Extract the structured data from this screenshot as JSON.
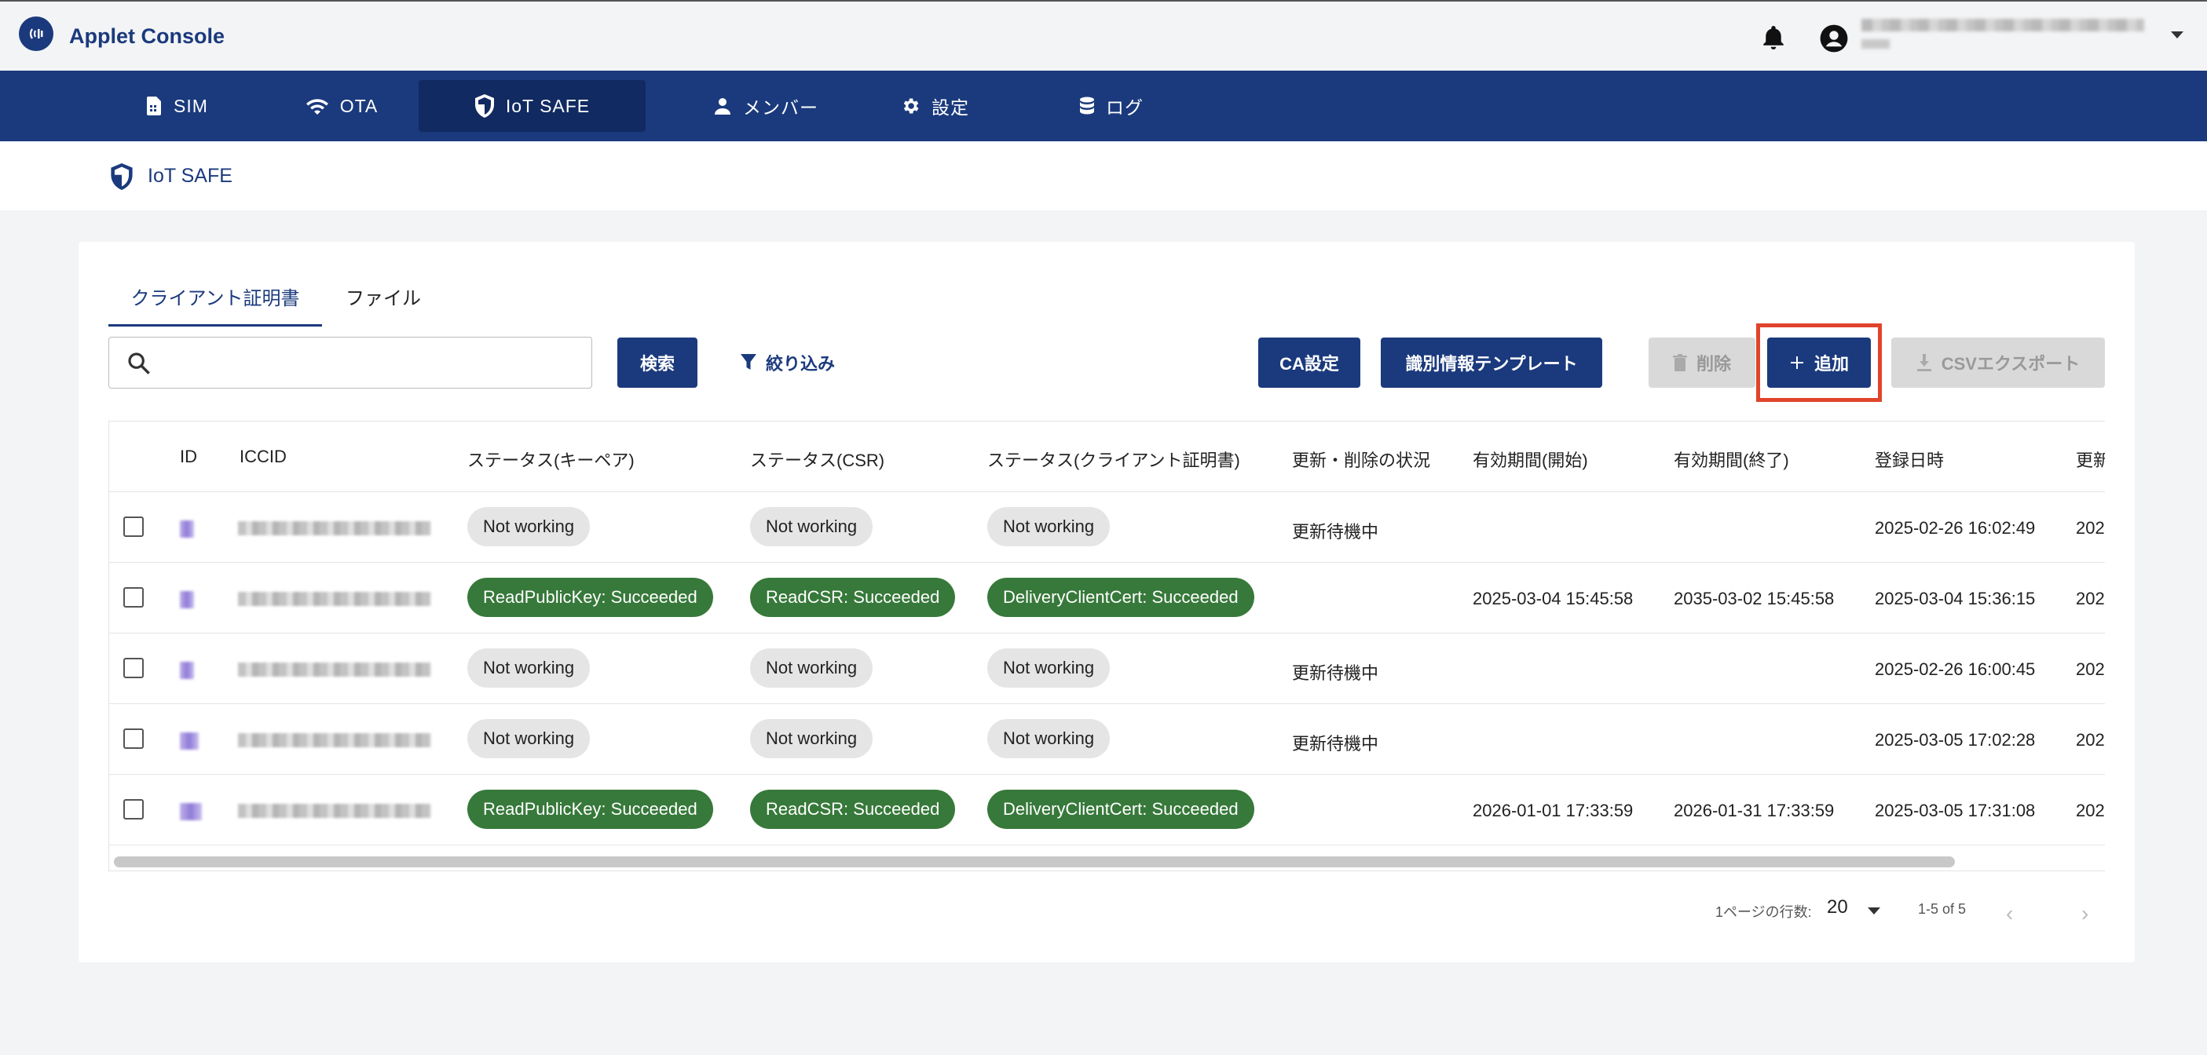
{
  "app": {
    "title": "Applet Console"
  },
  "nav": [
    {
      "label": "SIM",
      "icon": "sim-card-icon"
    },
    {
      "label": "OTA",
      "icon": "wifi-icon"
    },
    {
      "label": "IoT SAFE",
      "icon": "shield-icon"
    },
    {
      "label": "メンバー",
      "icon": "person-icon"
    },
    {
      "label": "設定",
      "icon": "gear-icon"
    },
    {
      "label": "ログ",
      "icon": "database-icon"
    }
  ],
  "page": {
    "title": "IoT SAFE"
  },
  "tabs": [
    {
      "label": "クライアント証明書",
      "active": true
    },
    {
      "label": "ファイル",
      "active": false
    }
  ],
  "search": {
    "value": "",
    "placeholder": ""
  },
  "buttons": {
    "search": "検索",
    "filter": "絞り込み",
    "ca_settings": "CA設定",
    "id_template": "識別情報テンプレート",
    "delete": "削除",
    "add": "追加",
    "csv_export": "CSVエクスポート"
  },
  "table": {
    "columns": [
      "ID",
      "ICCID",
      "ステータス(キーペア)",
      "ステータス(CSR)",
      "ステータス(クライアント証明書)",
      "更新・削除の状況",
      "有効期間(開始)",
      "有効期間(終了)",
      "登録日時",
      "更新"
    ],
    "rows": [
      {
        "keypair": "Not working",
        "csr": "Not working",
        "cert": "Not working",
        "update": "更新待機中",
        "start": "",
        "end": "",
        "registered": "2025-02-26 16:02:49",
        "updated": "202"
      },
      {
        "keypair": "ReadPublicKey: Succeeded",
        "csr": "ReadCSR: Succeeded",
        "cert": "DeliveryClientCert: Succeeded",
        "update": "",
        "start": "2025-03-04 15:45:58",
        "end": "2035-03-02 15:45:58",
        "registered": "2025-03-04 15:36:15",
        "updated": "202"
      },
      {
        "keypair": "Not working",
        "csr": "Not working",
        "cert": "Not working",
        "update": "更新待機中",
        "start": "",
        "end": "",
        "registered": "2025-02-26 16:00:45",
        "updated": "202"
      },
      {
        "keypair": "Not working",
        "csr": "Not working",
        "cert": "Not working",
        "update": "更新待機中",
        "start": "",
        "end": "",
        "registered": "2025-03-05 17:02:28",
        "updated": "202"
      },
      {
        "keypair": "ReadPublicKey: Succeeded",
        "csr": "ReadCSR: Succeeded",
        "cert": "DeliveryClientCert: Succeeded",
        "update": "",
        "start": "2026-01-01 17:33:59",
        "end": "2026-01-31 17:33:59",
        "registered": "2025-03-05 17:31:08",
        "updated": "202"
      }
    ]
  },
  "pagination": {
    "rows_per_page_label": "1ページの行数:",
    "rows_per_page": "20",
    "range": "1-5 of 5"
  },
  "colors": {
    "brand": "#1b3a7d",
    "success": "#37793a",
    "highlight": "#e0442b"
  }
}
